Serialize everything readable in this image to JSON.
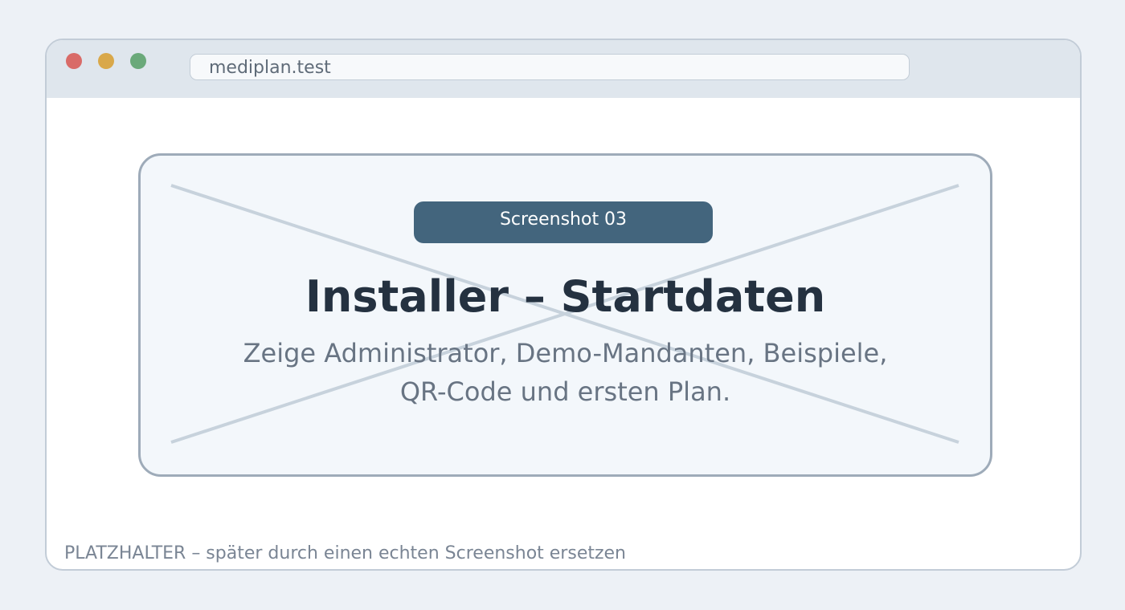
{
  "browser": {
    "url": "mediplan.test",
    "traffic_lights": {
      "close": "#d96b68",
      "minimize": "#d9a84a",
      "zoom": "#6aa97a"
    }
  },
  "placeholder": {
    "badge": "Screenshot 03",
    "title": "Installer – Startdaten",
    "description_lines": [
      "Zeige Administrator, Demo-Mandanten, Beispiele,",
      "QR-Code und ersten Plan."
    ]
  },
  "footer": {
    "note": "PLATZHALTER – später durch einen echten Screenshot ersetzen"
  },
  "colors": {
    "page_background": "#edf1f6",
    "title_bar": "#dfe6ed",
    "badge": "#43657d",
    "card_background": "#f3f7fb",
    "card_border": "#9eabb9",
    "cross_lines": "#c7d2dc",
    "headline": "#243140",
    "muted_text": "#687483"
  },
  "icons": {
    "cross": "placeholder-cross-icon"
  }
}
